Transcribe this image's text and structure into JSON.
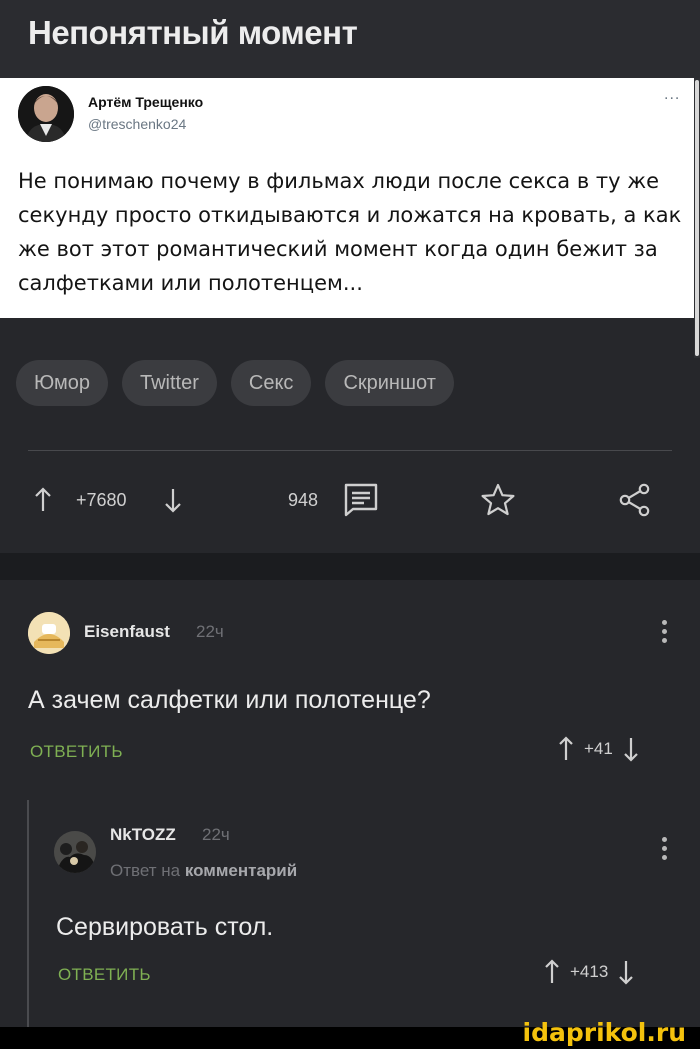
{
  "post": {
    "title": "Непонятный момент"
  },
  "tweet": {
    "author": "Артём Трещенко",
    "handle": "@treschenko24",
    "more": "...",
    "text": "Не понимаю почему в фильмах люди после секса в ту же секунду просто откидываются и ложатся на кровать, а как же вот этот романтический момент когда один бежит за салфетками или полотенцем..."
  },
  "tags": [
    "Юмор",
    "Twitter",
    "Секс",
    "Скриншот"
  ],
  "actions": {
    "rating": "+7680",
    "comments_count": "948"
  },
  "comments": [
    {
      "author": "Eisenfaust",
      "time": "22ч",
      "text": "А зачем салфетки или полотенце?",
      "reply_label": "ОТВЕТИТЬ",
      "rating": "+41"
    },
    {
      "author": "NkTOZZ",
      "time": "22ч",
      "reply_to_prefix": "Ответ на",
      "reply_to_target": "комментарий",
      "text": "Сервировать стол.",
      "reply_label": "ОТВЕТИТЬ",
      "rating": "+413"
    }
  ],
  "watermark": "idaprikol.ru",
  "colors": {
    "background": "#26272b",
    "tag_bg": "#3b3c40",
    "reply_green": "#7fb053",
    "watermark": "#f4c20d"
  },
  "icons": [
    "arrow-up-icon",
    "arrow-down-icon",
    "comment-icon",
    "star-icon",
    "share-icon",
    "kebab-menu-icon"
  ]
}
